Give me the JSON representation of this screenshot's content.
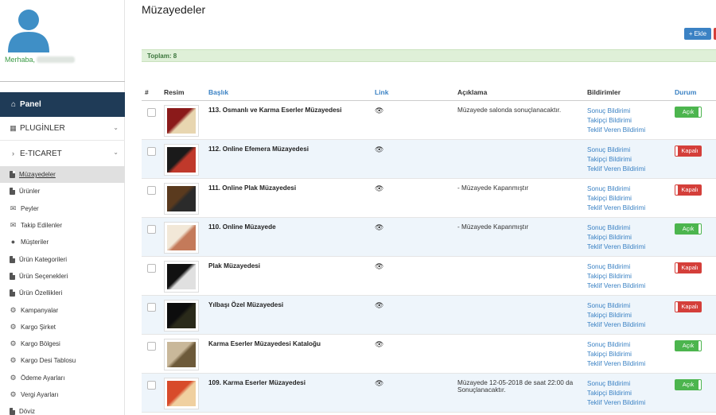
{
  "user": {
    "greeting": "Merhaba,"
  },
  "sidebar": {
    "panel_label": "Panel",
    "sections": [
      {
        "label": "PLUGİNLER"
      },
      {
        "label": "E-TICARET"
      }
    ],
    "items": [
      {
        "label": "Müzayedeler",
        "icon": "file-icon"
      },
      {
        "label": "Ürünler",
        "icon": "file-icon"
      },
      {
        "label": "Peyler",
        "icon": "envelope-icon"
      },
      {
        "label": "Takip Edilenler",
        "icon": "envelope-icon"
      },
      {
        "label": "Müşteriler",
        "icon": "user-icon"
      },
      {
        "label": "Ürün Kategorileri",
        "icon": "file-icon"
      },
      {
        "label": "Ürün Seçenekleri",
        "icon": "file-icon"
      },
      {
        "label": "Ürün Özellikleri",
        "icon": "file-icon"
      },
      {
        "label": "Kampanyalar",
        "icon": "gear-icon"
      },
      {
        "label": "Kargo Şirket",
        "icon": "gear-icon"
      },
      {
        "label": "Kargo Bölgesi",
        "icon": "gear-icon"
      },
      {
        "label": "Kargo Desi Tablosu",
        "icon": "gear-icon"
      },
      {
        "label": "Ödeme Ayarları",
        "icon": "gear-icon"
      },
      {
        "label": "Vergi Ayarları",
        "icon": "gear-icon"
      },
      {
        "label": "Döviz",
        "icon": "file-icon"
      }
    ]
  },
  "main": {
    "title": "Müzayedeler",
    "add_label": "Ekle",
    "total_label": "Toplam: 8",
    "columns": [
      "#",
      "Resim",
      "Başlık",
      "Link",
      "Açıklama",
      "Bildirimler",
      "Durum"
    ],
    "rows": [
      {
        "title": "113. Osmanlı ve Karma Eserler Müzayedesi",
        "desc": "Müzayede salonda sonuçlanacaktır.",
        "status": "Açık",
        "status_on": true
      },
      {
        "title": "112. Online Efemera Müzayedesi",
        "desc": "",
        "status": "Kapalı",
        "status_on": false
      },
      {
        "title": "111. Online Plak Müzayedesi",
        "desc": "- Müzayede Kapanmıştır",
        "status": "Kapalı",
        "status_on": false
      },
      {
        "title": "110. Online Müzayede",
        "desc": "- Müzayede Kapanmıştır",
        "status": "Açık",
        "status_on": true
      },
      {
        "title": "Plak Müzayedesi",
        "desc": "",
        "status": "Kapalı",
        "status_on": false
      },
      {
        "title": "Yılbaşı Özel Müzayedesi",
        "desc": "",
        "status": "Kapalı",
        "status_on": false
      },
      {
        "title": "Karma Eserler Müzayedesi Kataloğu",
        "desc": "",
        "status": "Açık",
        "status_on": true
      },
      {
        "title": "109. Karma Eserler Müzayedesi",
        "desc": "Müzayede 12-05-2018 de saat 22:00 da Sonuçlanacaktır.",
        "status": "Açık",
        "status_on": true
      }
    ],
    "notifications": [
      "Sonuç Bildirimi",
      "Takipçi Bildirimi",
      "Teklif Veren Bildirimi"
    ]
  },
  "colors": {
    "sidebar_active": "#1f3b57",
    "link": "#3b82c4",
    "status_open": "#4cb54e",
    "status_closed": "#d43f3a",
    "total_bg": "#dff0d8"
  }
}
